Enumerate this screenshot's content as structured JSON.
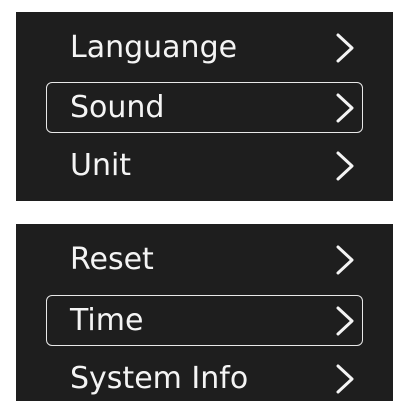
{
  "menus": [
    {
      "items": [
        {
          "label": "Languange",
          "selected": false,
          "icon": "chevron-right-icon"
        },
        {
          "label": "Sound",
          "selected": true,
          "icon": "chevron-right-icon"
        },
        {
          "label": "Unit",
          "selected": false,
          "icon": "chevron-right-icon"
        }
      ]
    },
    {
      "items": [
        {
          "label": "Reset",
          "selected": false,
          "icon": "chevron-right-icon"
        },
        {
          "label": "Time",
          "selected": true,
          "icon": "chevron-right-icon"
        },
        {
          "label": "System Info",
          "selected": false,
          "icon": "chevron-right-icon"
        }
      ]
    }
  ],
  "colors": {
    "panel_background": "#1e1e1e",
    "text": "#f4f4f4",
    "selection_border": "#e8e8e8"
  }
}
